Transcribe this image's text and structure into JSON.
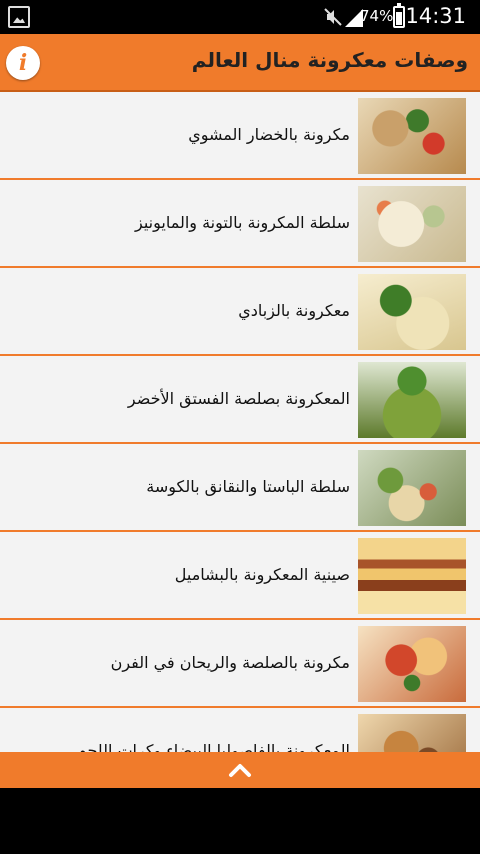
{
  "status_bar": {
    "battery_percent": "74%",
    "battery_level": 0.74,
    "time": "14:31",
    "icons": [
      "picture-notification-icon",
      "mute-icon",
      "signal-icon",
      "battery-icon"
    ]
  },
  "app_bar": {
    "title": "وصفات معكرونة منال العالم",
    "info_icon": "info-icon",
    "info_glyph": "i",
    "color": "#f07b2b"
  },
  "recipes": [
    {
      "label": "مكرونة بالخضار المشوي"
    },
    {
      "label": "سلطة المكرونة بالتونة والمايونيز"
    },
    {
      "label": "معكرونة بالزبادي"
    },
    {
      "label": "المعكرونة بصلصة الفستق الأخضر"
    },
    {
      "label": "سلطة الباستا والنقانق بالكوسة"
    },
    {
      "label": "صينية المعكرونة بالبشاميل"
    },
    {
      "label": "مكرونة بالصلصة والريحان في الفرن"
    },
    {
      "label": "المعكرونة بالفاصوليا البيضاء وكرات اللحم"
    }
  ],
  "bottom_bar": {
    "icon": "chevron-up-icon"
  }
}
